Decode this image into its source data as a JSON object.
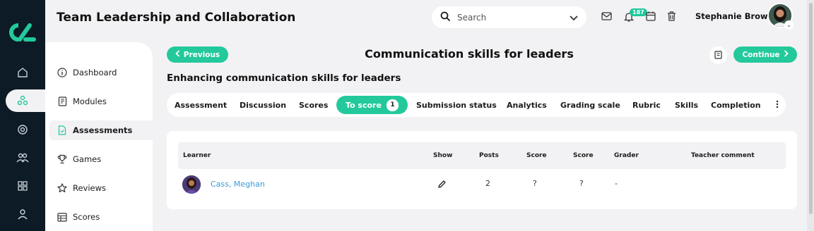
{
  "app": {
    "title": "Team Leadership and Collaboration"
  },
  "search": {
    "placeholder": "Search"
  },
  "notifications": {
    "count": "187"
  },
  "user": {
    "name": "Stephanie Brown"
  },
  "rail": {
    "icons": [
      "home-icon",
      "network-icon",
      "target-icon",
      "users-icon",
      "grid-icon",
      "profile-icon"
    ],
    "active": "network-icon"
  },
  "subnav": {
    "items": [
      {
        "label": "Dashboard",
        "icon": "info-icon"
      },
      {
        "label": "Modules",
        "icon": "book-icon"
      },
      {
        "label": "Assessments",
        "icon": "document-icon"
      },
      {
        "label": "Games",
        "icon": "trophy-icon"
      },
      {
        "label": "Reviews",
        "icon": "star-icon"
      },
      {
        "label": "Scores",
        "icon": "table-icon"
      }
    ],
    "active": "Assessments"
  },
  "page": {
    "prev_label": "Previous",
    "title": "Communication skills for leaders",
    "continue_label": "Continue",
    "subtitle": "Enhancing communication skills for leaders"
  },
  "tabs": [
    {
      "label": "Assessment"
    },
    {
      "label": "Discussion"
    },
    {
      "label": "Scores"
    },
    {
      "label": "To score",
      "count": "1",
      "active": true
    },
    {
      "label": "Submission status"
    },
    {
      "label": "Analytics"
    },
    {
      "label": "Grading scale"
    },
    {
      "label": "Rubric"
    },
    {
      "label": "Skills"
    },
    {
      "label": "Completion"
    }
  ],
  "table": {
    "columns": [
      "Learner",
      "Show",
      "Posts",
      "Score",
      "Score",
      "Grader",
      "Teacher comment"
    ],
    "rows": [
      {
        "learner": "Cass, Meghan",
        "show": "edit-icon",
        "posts": "2",
        "score1": "?",
        "score2": "?",
        "grader": "-",
        "comment": ""
      }
    ]
  },
  "colors": {
    "accent": "#23c99b",
    "rail": "#0d1b26",
    "link": "#3a9ad9",
    "background": "#f2f2f4"
  }
}
